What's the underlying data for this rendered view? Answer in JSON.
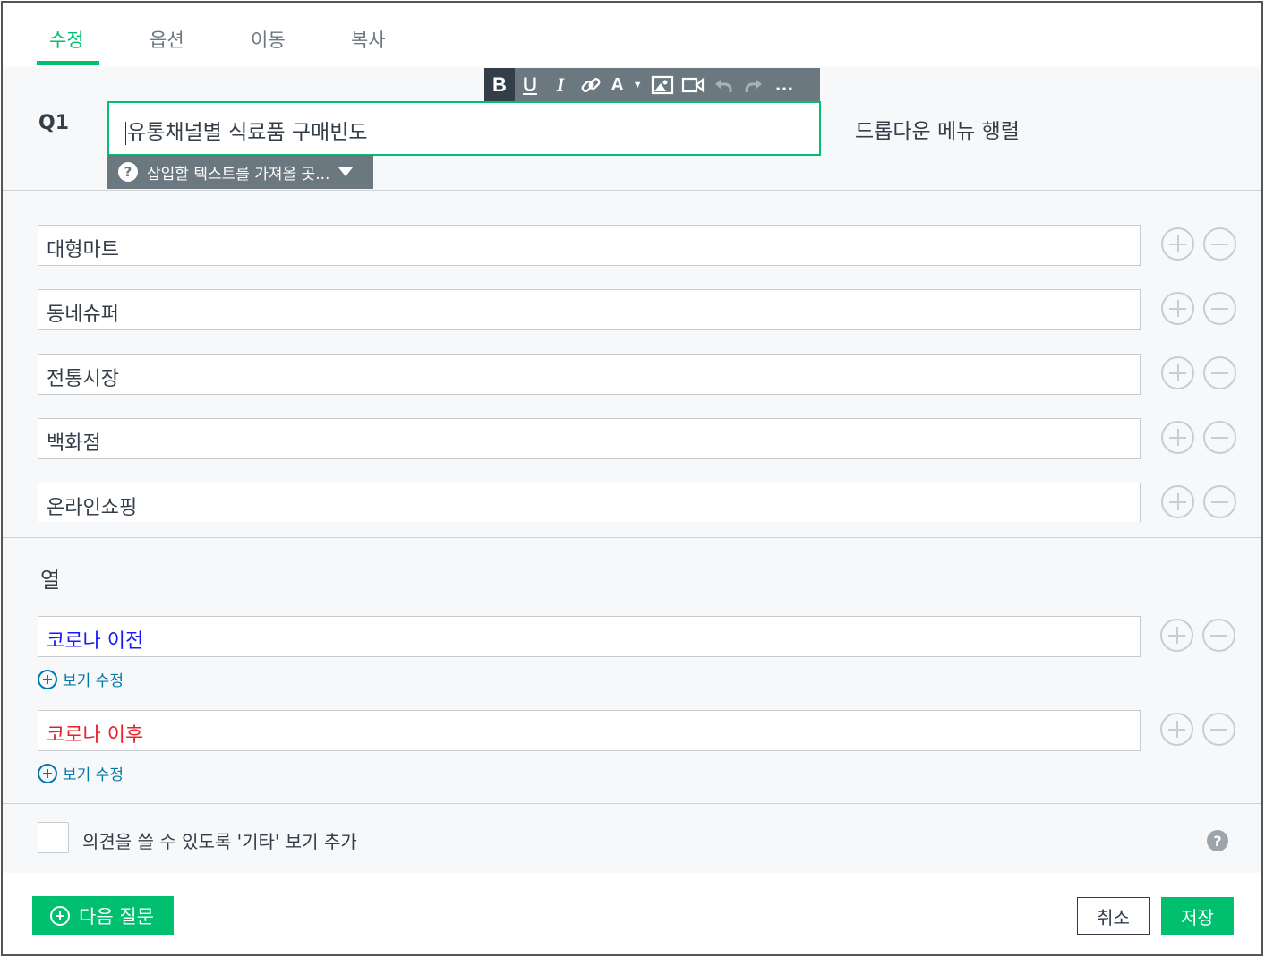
{
  "tabs": [
    {
      "label": "수정",
      "active": true
    },
    {
      "label": "옵션",
      "active": false
    },
    {
      "label": "이동",
      "active": false
    },
    {
      "label": "복사",
      "active": false
    }
  ],
  "toolbar": {
    "buttons": [
      "bold",
      "underline",
      "italic",
      "link",
      "text-color",
      "image",
      "video",
      "undo",
      "redo",
      "more"
    ],
    "more_label": "..."
  },
  "question": {
    "number": "Q1",
    "text": "유통채널별 식료품 구매빈도",
    "piping_label": "삽입할 텍스트를 가져올 곳...",
    "type_label": "드롭다운 메뉴 행렬"
  },
  "rows": [
    {
      "label": "대형마트"
    },
    {
      "label": "동네슈퍼"
    },
    {
      "label": "전통시장"
    },
    {
      "label": "백화점"
    },
    {
      "label": "온라인쇼핑"
    }
  ],
  "columns": {
    "title": "열",
    "items": [
      {
        "label": "코로나 이전",
        "color": "#1a1aff"
      },
      {
        "label": "코로나 이후",
        "color": "#e8222b"
      }
    ],
    "add_choice_label": "보기 수정"
  },
  "other_option": {
    "label": "의견을 쓸 수 있도록 '기타' 보기 추가",
    "checked": false
  },
  "footer": {
    "next_label": "다음 질문",
    "cancel_label": "취소",
    "save_label": "저장"
  },
  "colors": {
    "accent": "#00bf6f",
    "toolbar": "#6b787f",
    "link": "#0077a8"
  }
}
